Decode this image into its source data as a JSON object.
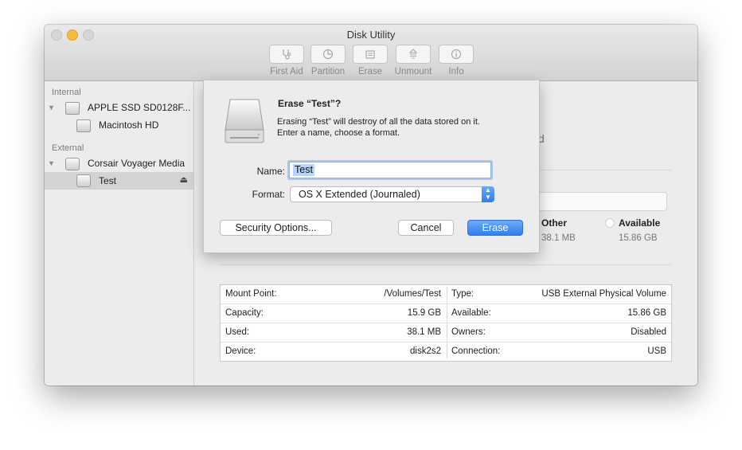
{
  "window": {
    "title": "Disk Utility"
  },
  "toolbar": {
    "first_aid": "First Aid",
    "partition": "Partition",
    "erase": "Erase",
    "unmount": "Unmount",
    "info": "Info"
  },
  "sidebar": {
    "internal_header": "Internal",
    "external_header": "External",
    "internal_disk": "APPLE SSD SD0128F...",
    "internal_volume": "Macintosh HD",
    "external_disk": "Corsair Voyager Media",
    "external_volume": "Test"
  },
  "content": {
    "partial_text": "d",
    "legend": {
      "other_label": "Other",
      "other_value": "38.1 MB",
      "available_label": "Available",
      "available_value": "15.86 GB"
    },
    "info_rows": [
      {
        "k1": "Mount Point:",
        "v1": "/Volumes/Test",
        "k2": "Type:",
        "v2": "USB External Physical Volume"
      },
      {
        "k1": "Capacity:",
        "v1": "15.9 GB",
        "k2": "Available:",
        "v2": "15.86 GB"
      },
      {
        "k1": "Used:",
        "v1": "38.1 MB",
        "k2": "Owners:",
        "v2": "Disabled"
      },
      {
        "k1": "Device:",
        "v1": "disk2s2",
        "k2": "Connection:",
        "v2": "USB"
      }
    ]
  },
  "dialog": {
    "title": "Erase “Test”?",
    "message_line1": "Erasing “Test” will destroy of all the data stored on it.",
    "message_line2": "Enter a name, choose a format.",
    "name_label": "Name:",
    "name_value": "Test",
    "format_label": "Format:",
    "format_value": "OS X Extended (Journaled)",
    "security_button": "Security Options...",
    "cancel_button": "Cancel",
    "erase_button": "Erase"
  },
  "colors": {
    "accent": "#2e7ff0",
    "selection": "#b5d4fe",
    "minimize": "#f6bd3c"
  }
}
